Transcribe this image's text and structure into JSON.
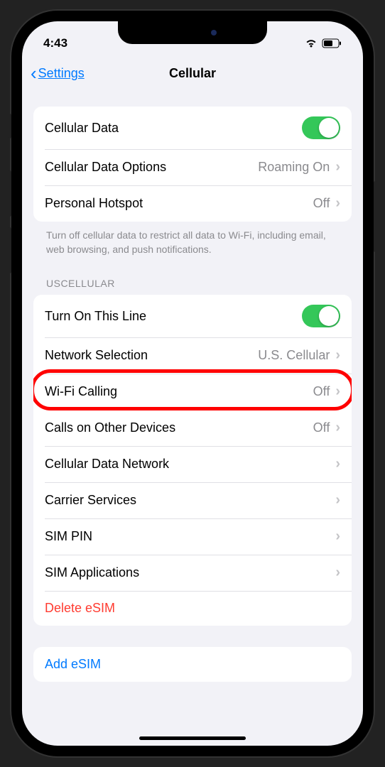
{
  "status": {
    "time": "4:43"
  },
  "nav": {
    "back_label": "Settings",
    "title": "Cellular"
  },
  "group1": {
    "cellular_data": "Cellular Data",
    "cellular_data_options": "Cellular Data Options",
    "cellular_data_options_value": "Roaming On",
    "personal_hotspot": "Personal Hotspot",
    "personal_hotspot_value": "Off"
  },
  "footer1": "Turn off cellular data to restrict all data to Wi-Fi, including email, web browsing, and push notifications.",
  "carrier_header": "USCELLULAR",
  "group2": {
    "turn_on_line": "Turn On This Line",
    "network_selection": "Network Selection",
    "network_selection_value": "U.S. Cellular",
    "wifi_calling": "Wi-Fi Calling",
    "wifi_calling_value": "Off",
    "calls_other": "Calls on Other Devices",
    "calls_other_value": "Off",
    "data_network": "Cellular Data Network",
    "carrier_services": "Carrier Services",
    "sim_pin": "SIM PIN",
    "sim_apps": "SIM Applications",
    "delete_esim": "Delete eSIM"
  },
  "group3": {
    "add_esim": "Add eSIM"
  }
}
